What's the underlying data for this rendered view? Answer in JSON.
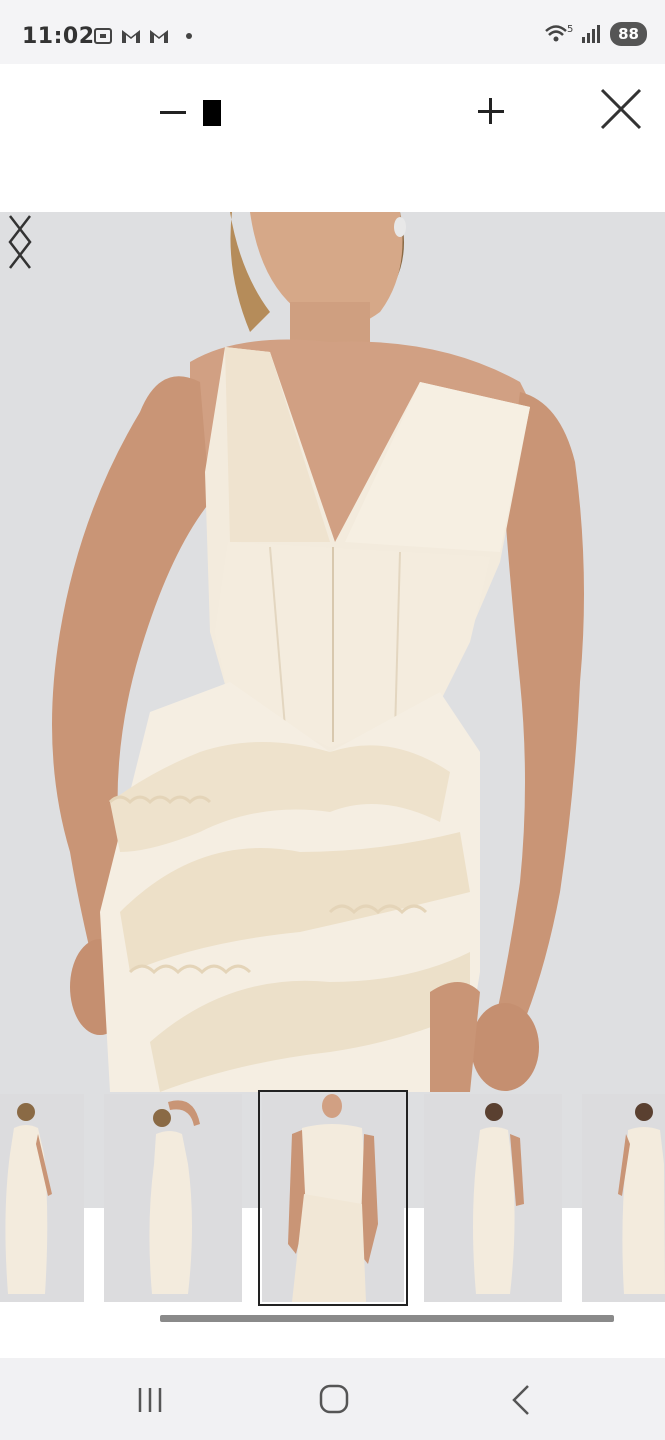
{
  "status_bar": {
    "time": "11:02",
    "notification_icons": [
      "screenshot-icon",
      "gmail-icon",
      "gmail-icon"
    ],
    "wifi_label": "5",
    "battery": "88"
  },
  "viewer": {
    "zoom_out_icon": "minus-icon",
    "zoom_in_icon": "plus-icon",
    "close_icon": "close-icon",
    "prev_icon": "chevron-left-icon",
    "next_icon": "chevron-right-icon"
  },
  "thumbnails": {
    "count": 5,
    "active_index": 2
  },
  "system_nav": {
    "recents_icon": "recents-icon",
    "home_icon": "home-icon",
    "back_icon": "back-icon"
  },
  "colors": {
    "background": "#dedfe1",
    "dress": "#f3ead9",
    "skin": "#c9987a"
  }
}
